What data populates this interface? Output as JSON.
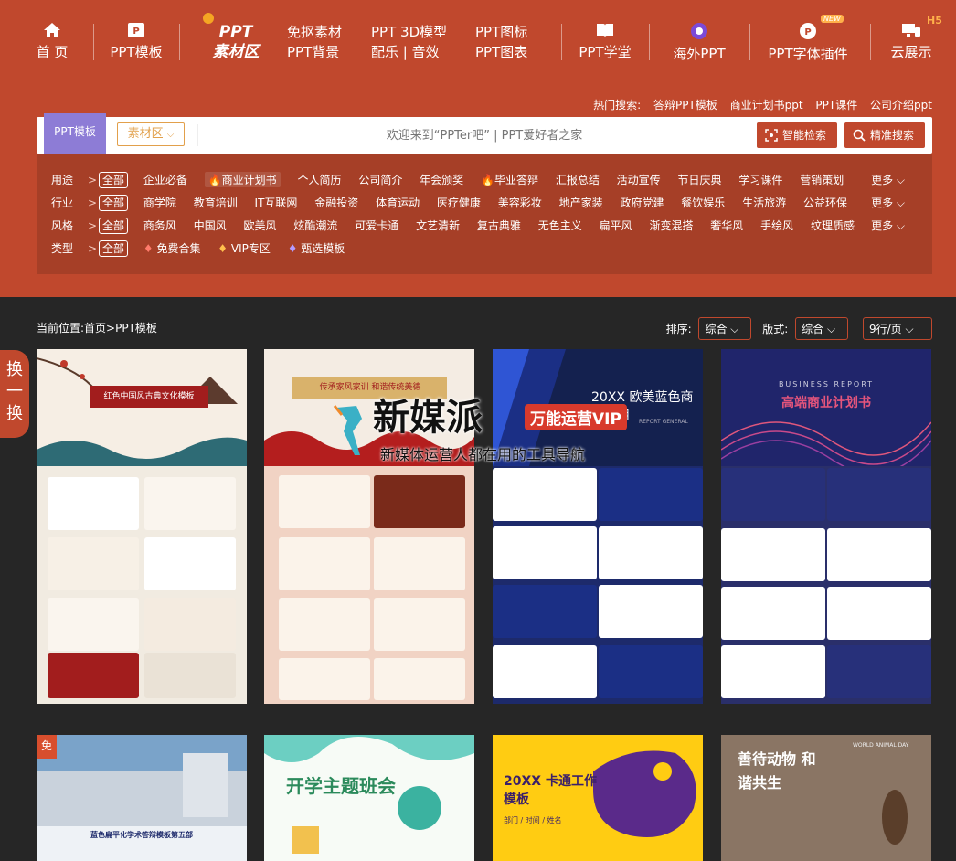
{
  "nav": {
    "home": "首 页",
    "ppt_template": "PPT模板",
    "material_line1": "PPT",
    "material_line2": "素材区",
    "col1": [
      "免抠素材",
      "PPT背景"
    ],
    "col2": [
      "PPT 3D模型",
      "配乐 | 音效"
    ],
    "col3": [
      "PPT图标",
      "PPT图表"
    ],
    "school": "PPT学堂",
    "overseas": "海外PPT",
    "font_plugin": "PPT字体插件",
    "font_badge": "NEW",
    "cloud": "云展示",
    "cloud_badge": "H5"
  },
  "hot_search": {
    "label": "热门搜索:",
    "items": [
      "答辩PPT模板",
      "商业计划书ppt",
      "PPT课件",
      "公司介绍ppt"
    ]
  },
  "search": {
    "tab": "PPT模板",
    "scope": "素材区",
    "placeholder": "欢迎来到“PPTer吧” | PPT爱好者之家",
    "smart_btn": "智能检索",
    "exact_btn": "精准搜索"
  },
  "filters": {
    "all_label": "全部",
    "more_label": "更多",
    "rows": [
      {
        "label": "用途",
        "tags": [
          "企业必备",
          "商业计划书",
          "个人简历",
          "公司简介",
          "年会颁奖",
          "毕业答辩",
          "汇报总结",
          "活动宣传",
          "节日庆典",
          "学习课件",
          "营销策划"
        ]
      },
      {
        "label": "行业",
        "tags": [
          "商学院",
          "教育培训",
          "IT互联网",
          "金融投资",
          "体育运动",
          "医疗健康",
          "美容彩妆",
          "地产家装",
          "政府党建",
          "餐饮娱乐",
          "生活旅游",
          "公益环保"
        ]
      },
      {
        "label": "风格",
        "tags": [
          "商务风",
          "中国风",
          "欧美风",
          "炫酷潮流",
          "可爱卡通",
          "文艺清新",
          "复古典雅",
          "无色主义",
          "扁平风",
          "渐变混搭",
          "奢华风",
          "手绘风",
          "纹理质感"
        ]
      },
      {
        "label": "类型",
        "tags": [
          "免费合集",
          "VIP专区",
          "甄选模板"
        ]
      }
    ]
  },
  "breadcrumb": "当前位置:首页>PPT模板",
  "sort": {
    "sort_label": "排序:",
    "sort_value": "综合",
    "format_label": "版式:",
    "format_value": "综合",
    "per_page": "9行/页"
  },
  "swap_label": [
    "换",
    "一",
    "换"
  ],
  "cards": [
    {
      "title": "红色中国风古典文化模板"
    },
    {
      "title": "传承家风家训 和谐传统美德"
    },
    {
      "title": "20XX 欧美蓝色商务通用",
      "sub": "REPORT GENERAL"
    },
    {
      "title": "高端商业计划书",
      "sub": "BUSINESS REPORT"
    },
    {
      "title": "蓝色扁平化学术答辩模板第五部",
      "badge": "免"
    },
    {
      "title": "开学主题班会"
    },
    {
      "title": "20XX 卡通工作模板",
      "sub": "部门 / 时间 / 姓名"
    },
    {
      "title": "善待动物 和谐共生",
      "sub": "WORLD ANIMAL DAY"
    }
  ],
  "watermark": {
    "title": "新媒派",
    "vip": "万能运营VIP",
    "sub": "新媒体运营人都在用的工具导航"
  }
}
